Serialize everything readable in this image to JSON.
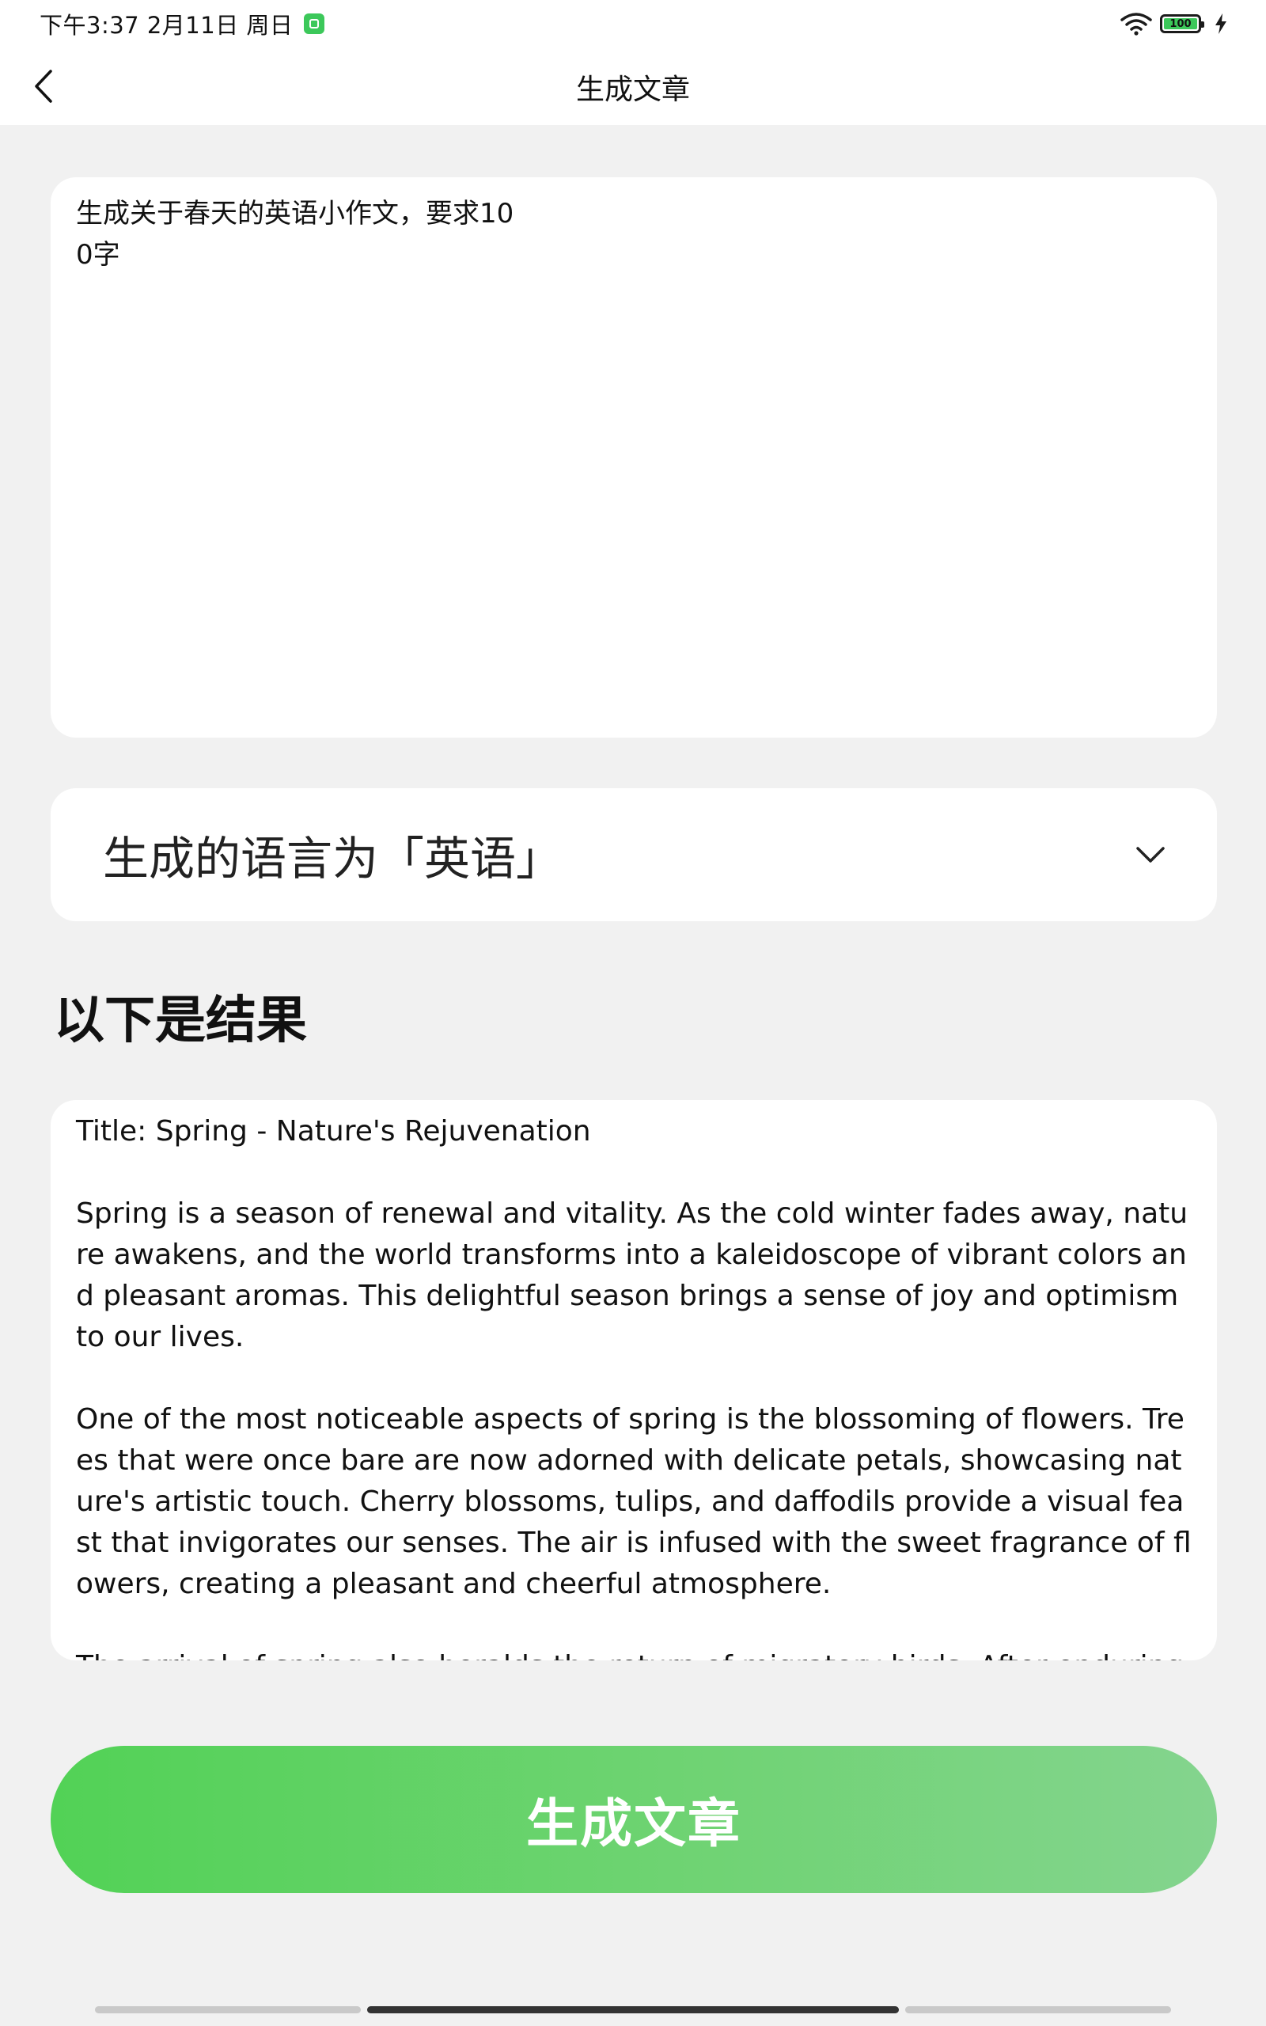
{
  "status_bar": {
    "time": "下午3:37 2月11日 周日",
    "battery_level": "100",
    "battery_color": "#3cc85a"
  },
  "header": {
    "title": "生成文章"
  },
  "prompt": {
    "text": "生成关于春天的英语小作文，要求100字"
  },
  "language_select": {
    "label": "生成的语言为「英语」"
  },
  "results": {
    "heading": "以下是结果",
    "paragraphs": [
      "Title: Spring - Nature's Rejuvenation",
      "Spring is a season of renewal and vitality. As the cold winter fades away, nature awakens, and the world transforms into a kaleidoscope of vibrant colors and pleasant aromas. This delightful season brings a sense of joy and optimism to our lives.",
      "One of the most noticeable aspects of spring is the blossoming of flowers. Trees that were once bare are now adorned with delicate petals, showcasing nature's artistic touch. Cherry blossoms, tulips, and daffodils provide a visual feast that invigorates our senses. The air is infused with the sweet fragrance of flowers, creating a pleasant and cheerful atmosphere.",
      "The arrival of spring also heralds the return of migratory birds. After enduring a long"
    ]
  },
  "generate_button": {
    "label": "生成文章"
  },
  "colors": {
    "accent_green": "#52d256",
    "background": "#f1f1f1"
  }
}
